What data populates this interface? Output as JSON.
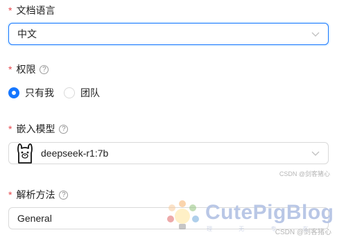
{
  "form": {
    "required_mark": "*",
    "language": {
      "label": "文档语言",
      "value": "中文"
    },
    "permission": {
      "label": "权限",
      "help": "?",
      "options": [
        {
          "label": "只有我",
          "checked": true
        },
        {
          "label": "团队",
          "checked": false
        }
      ]
    },
    "embedding_model": {
      "label": "嵌入模型",
      "help": "?",
      "value": "deepseek-r1:7b"
    },
    "parse_method": {
      "label": "解析方法",
      "help": "?",
      "value": "General"
    }
  },
  "colors": {
    "accent": "#1677ff",
    "required": "#e5484d",
    "border": "#d9d9d9"
  },
  "watermark": {
    "brand": "CutePigBlog",
    "sub": "理 无 专 在",
    "csdn_top": "CSDN @剑客猪心",
    "csdn_bottom": "CSDN @剑客猪心"
  }
}
